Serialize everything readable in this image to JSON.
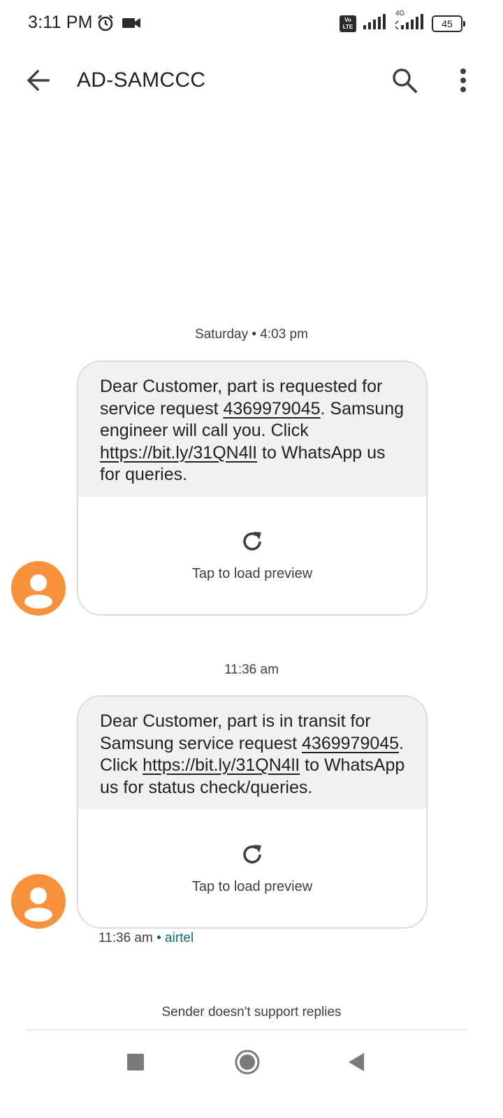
{
  "status_bar": {
    "time": "3:11 PM",
    "volte_label": "Vo\nLTE",
    "network_type": "4G",
    "battery_level": "45"
  },
  "header": {
    "title": "AD-SAMCCC"
  },
  "messages": [
    {
      "timestamp": "Saturday • 4:03 pm",
      "text_parts": [
        "Dear Customer, part is requested for service request ",
        "4369979045",
        ". Samsung engineer will call you. Click ",
        "https://bit.ly/31QN4lI",
        " to WhatsApp us for queries."
      ],
      "preview_label": "Tap to load preview"
    },
    {
      "timestamp": "11:36 am",
      "text_parts": [
        "Dear Customer, part is in transit for Samsung service request ",
        "4369979045",
        ". Click ",
        "https://bit.ly/31QN4lI",
        " to WhatsApp us for status check/queries."
      ],
      "preview_label": "Tap to load preview",
      "meta_time": "11:36 am",
      "meta_separator": " • ",
      "meta_carrier": "airtel"
    }
  ],
  "footer": {
    "no_reply_text": "Sender doesn't support replies"
  },
  "colors": {
    "avatar_bg": "#f7913d",
    "bubble_bg": "#f1f1f1",
    "carrier_text": "#0b6e75"
  }
}
